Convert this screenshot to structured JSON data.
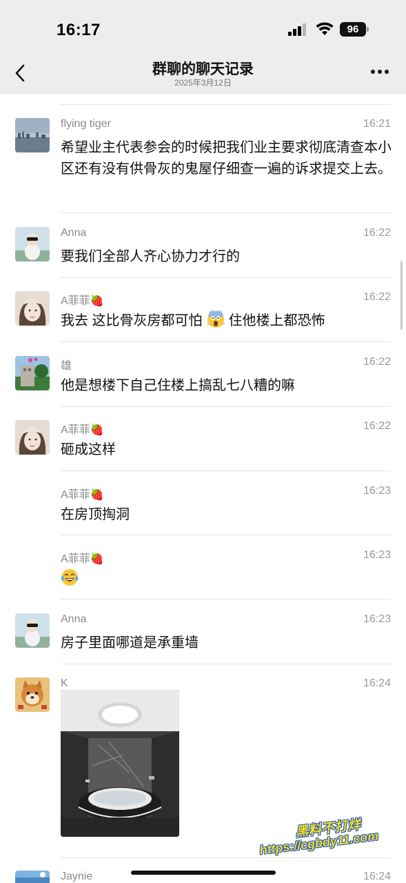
{
  "status": {
    "time": "16:17",
    "battery": "96"
  },
  "nav": {
    "title": "群聊的聊天记录",
    "subtitle": "2025年3月12日"
  },
  "messages": [
    {
      "sender": "flying tiger",
      "time": "16:21",
      "text": "希望业主代表参会的时候把我们业主要求彻底清查本小区还有没有供骨灰的鬼屋仔细查一遍的诉求提交上去。"
    },
    {
      "sender": "Anna",
      "time": "16:22",
      "text": "要我们全部人齐心协力才行的"
    },
    {
      "sender": "A菲菲🍓",
      "time": "16:22",
      "text_before": "我去 这比骨灰房都可怕",
      "text_after": "住他楼上都恐怖"
    },
    {
      "sender": "雄",
      "time": "16:22",
      "text": "他是想楼下自己住楼上搞乱七八糟的嘛"
    },
    {
      "sender": "A菲菲🍓",
      "time": "16:22",
      "text": "砸成这样"
    },
    {
      "sender": "A菲菲🍓",
      "time": "16:23",
      "text": "在房顶掏洞"
    },
    {
      "sender": "A菲菲🍓",
      "time": "16:23",
      "text": ""
    },
    {
      "sender": "Anna",
      "time": "16:23",
      "text": "房子里面哪道是承重墙"
    },
    {
      "sender": "K",
      "time": "16:24"
    },
    {
      "sender": "Jaynie",
      "time": "16:24"
    }
  ],
  "icons": {
    "back": "chevron-left-icon",
    "more": "more-dots-icon",
    "scream": "screaming-face-emoji",
    "tears": "tears-of-joy-emoji"
  },
  "watermark": {
    "line1": "黑料不打烊",
    "line2": "https://cgbdy11.com"
  }
}
